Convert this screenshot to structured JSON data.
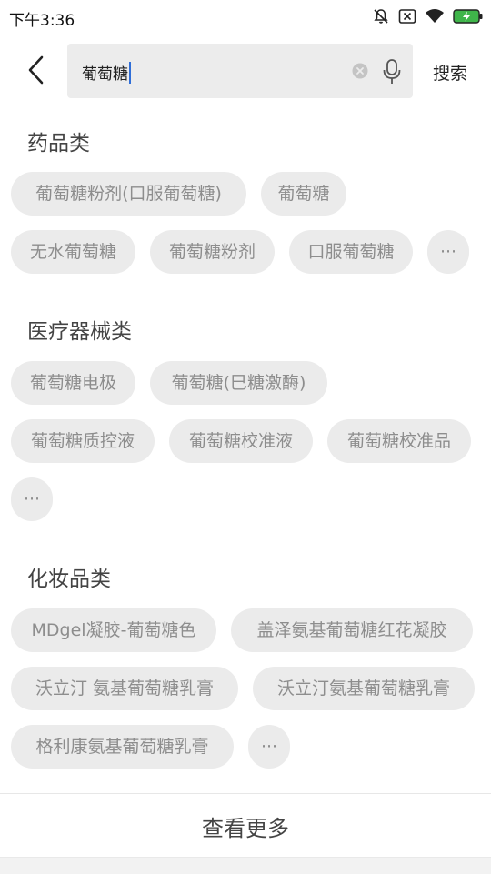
{
  "status": {
    "time": "下午3:36",
    "icons": [
      "mute-bell-icon",
      "sim-x-icon",
      "wifi-icon",
      "battery-charging-icon"
    ]
  },
  "search": {
    "value": "葡萄糖",
    "search_label": "搜索",
    "back_icon": "back-chevron-icon",
    "clear_icon": "clear-icon",
    "mic_icon": "microphone-icon"
  },
  "sections": [
    {
      "title": "药品类",
      "chips": [
        "葡萄糖粉剂(口服葡萄糖)",
        "葡萄糖",
        "无水葡萄糖",
        "葡萄糖粉剂",
        "口服葡萄糖",
        "···"
      ]
    },
    {
      "title": "医疗器械类",
      "chips": [
        "葡萄糖电极",
        "葡萄糖(巳糖激酶)",
        "葡萄糖质控液",
        "葡萄糖校准液",
        "葡萄糖校准品",
        "···"
      ]
    },
    {
      "title": "化妆品类",
      "chips": [
        "MDgel凝胶-葡萄糖色",
        "盖泽氨基葡萄糖红花凝胶",
        "沃立汀 氨基葡萄糖乳膏",
        "沃立汀氨基葡萄糖乳膏",
        "格利康氨基葡萄糖乳膏",
        "···"
      ]
    }
  ],
  "footer": {
    "more_label": "查看更多"
  },
  "colors": {
    "chip_bg": "#ebebeb",
    "chip_text": "#8d8d8d",
    "caret": "#2f6ed8",
    "battery": "#3fb54a"
  }
}
